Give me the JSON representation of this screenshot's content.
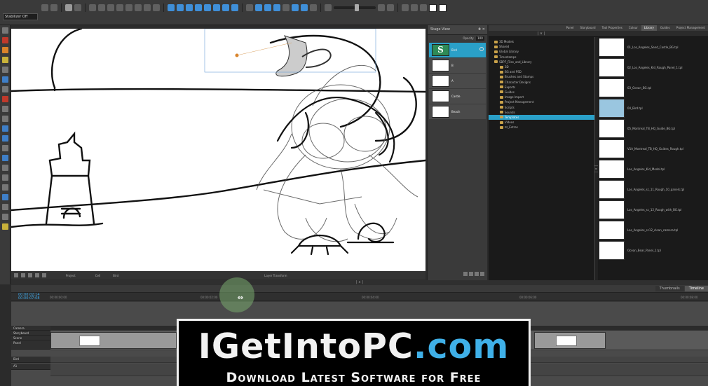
{
  "toolbar": {
    "stabilizer_label": "Stabilizer Off"
  },
  "stage_bar": {
    "label1": "Project",
    "label2": "Cell",
    "label3": "Bird",
    "label_center": "Layer Transform"
  },
  "layers_panel": {
    "title": "Stage View",
    "opacity_label": "Opacity",
    "opacity_value": "100",
    "layers": [
      {
        "name": "Bird"
      },
      {
        "name": "B"
      },
      {
        "name": "A"
      },
      {
        "name": "Castle"
      },
      {
        "name": "Beach"
      }
    ]
  },
  "right_tabs": [
    "Panel",
    "Storyboard",
    "Tool Properties",
    "Colour",
    "Library",
    "Guides",
    "Project Management"
  ],
  "right_active_tab": "Library",
  "library_tree": [
    {
      "name": "3D Models",
      "indent": 1
    },
    {
      "name": "Shared",
      "indent": 1
    },
    {
      "name": "Global Library",
      "indent": 1
    },
    {
      "name": "Timestamps",
      "indent": 1
    },
    {
      "name": "SBP7_Files_and_Library",
      "indent": 1
    },
    {
      "name": "3D",
      "indent": 2
    },
    {
      "name": "BG and PSD",
      "indent": 2
    },
    {
      "name": "Brushes and Stamps",
      "indent": 2
    },
    {
      "name": "Character Designs",
      "indent": 2
    },
    {
      "name": "Exports",
      "indent": 2
    },
    {
      "name": "Guides",
      "indent": 2
    },
    {
      "name": "Image Import",
      "indent": 2
    },
    {
      "name": "Project Management",
      "indent": 2
    },
    {
      "name": "Scripts",
      "indent": 2
    },
    {
      "name": "Sounds",
      "indent": 2
    },
    {
      "name": "Templates",
      "indent": 2,
      "selected": true
    },
    {
      "name": "Videos",
      "indent": 2
    },
    {
      "name": "zz_Extras",
      "indent": 2
    }
  ],
  "library_files": [
    {
      "name": "01_Los_Angeles_Sand_Castle_BG.tpl"
    },
    {
      "name": "02_Los_Angeles_Kid_Rough_Panel_1.tpl"
    },
    {
      "name": "03_Ocean_BG.tpl"
    },
    {
      "name": "04_Bird.tpl",
      "selected": true
    },
    {
      "name": "05_Montreal_TB_HQ_Guide_BG.tpl"
    },
    {
      "name": "V1A_Montreal_TB_HQ_Guides_Rough.tpl"
    },
    {
      "name": "Los_Angeles_Kid_Model.tpl"
    },
    {
      "name": "Los_Angeles_sc_11_Rough_10_panels.tpl"
    },
    {
      "name": "Los_Angeles_sc_12_Rough_with_BG.tpl"
    },
    {
      "name": "Los_Angeles_sc12_clean_camera.tpl"
    },
    {
      "name": "Ocean_Bear_Panel_1.tpl"
    }
  ],
  "timeline": {
    "tabs": [
      "Thumbnails",
      "Timeline"
    ],
    "active_tab": "Timeline",
    "current_time": "00:00:02:14",
    "current_time2": "00:00:07:08",
    "ticks": [
      "00:00:00:00",
      "00:00:02:00",
      "00:00:04:00",
      "00:00:06:00",
      "00:00:08:00",
      "00:00:10:00"
    ],
    "tracks": [
      "Camera",
      "Storyboard",
      "Scene",
      "Panel"
    ],
    "audio_track": "A1",
    "bird_track": "Bird"
  },
  "watermark": {
    "title_a": "IGetInto",
    "title_b": "PC",
    "title_c": ".com",
    "subtitle": "Download Latest Software for Free"
  },
  "colors": {
    "accent": "#2aa0c8",
    "panel": "#3a3a3a",
    "watermark_blue": "#3fb0e8"
  }
}
